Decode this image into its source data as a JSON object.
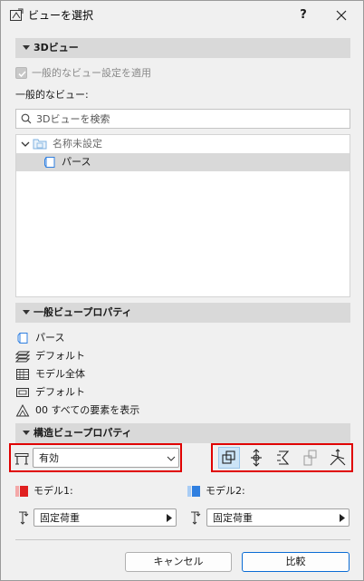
{
  "window": {
    "title": "ビューを選択",
    "help_glyph": "?",
    "close_icon": "close-icon"
  },
  "section_3d": {
    "label": "3Dビュー",
    "apply_general_checkbox": {
      "label": "一般的なビュー設定を適用",
      "checked": true,
      "disabled": true
    },
    "general_views_label": "一般的なビュー:",
    "search": {
      "placeholder": "3Dビューを検索",
      "value": ""
    },
    "tree": [
      {
        "label": "名称未設定",
        "expanded": true,
        "level": 0,
        "icon": "folder-icon"
      },
      {
        "label": "パース",
        "selected": true,
        "level": 1,
        "icon": "perspective-view-icon"
      }
    ]
  },
  "section_general": {
    "label": "一般ビュープロパティ",
    "rows": [
      {
        "icon": "perspective-icon",
        "label": "パース"
      },
      {
        "icon": "layer-combination-icon",
        "label": "デフォルト"
      },
      {
        "icon": "model-view-icon",
        "label": "モデル全体"
      },
      {
        "icon": "pen-set-icon",
        "label": "デフォルト"
      },
      {
        "icon": "structural-display-icon",
        "label": "00 すべての要素を表示"
      }
    ]
  },
  "section_structural": {
    "label": "構造ビュープロパティ",
    "mode_select": {
      "value": "有効"
    },
    "toolbar_icons": [
      "analytical-model-icon",
      "supports-icon",
      "loads-icon",
      "releases-icon",
      "local-axes-icon"
    ],
    "toolbar_active_index": 0,
    "model1": {
      "label": "モデル1:",
      "color": "#e02020",
      "load_select": "固定荷重"
    },
    "model2": {
      "label": "モデル2:",
      "color": "#2f7fe0",
      "load_select": "固定荷重"
    }
  },
  "buttons": {
    "cancel": "キャンセル",
    "compare": "比較"
  },
  "colors": {
    "highlight_red": "#e00000",
    "accent_blue": "#0b6cd4",
    "active_tool_bg": "#cce4f7"
  }
}
